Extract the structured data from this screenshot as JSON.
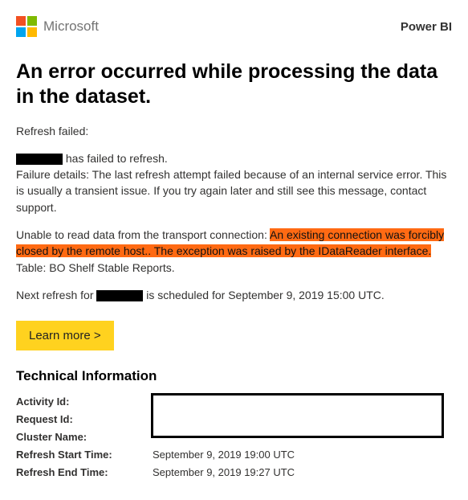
{
  "header": {
    "brand": "Microsoft",
    "product": "Power BI"
  },
  "title": "An error occurred while processing the data in the dataset.",
  "refresh_failed_label": "Refresh failed:",
  "body": {
    "failed_suffix": "has failed to refresh.",
    "failure_details": "Failure details: The last refresh attempt failed because of an internal service error. This is usually a transient issue. If you try again later and still see this message, contact support.",
    "unable_prefix": "Unable to read data from the transport connection: ",
    "highlighted": "An existing connection was forcibly closed by the remote host.. The exception was raised by the IDataReader interface.",
    "unable_suffix": " Table: BO Shelf Stable Reports.",
    "next_refresh_prefix": "Next refresh for ",
    "next_refresh_suffix": " is scheduled for September 9, 2019 15:00 UTC."
  },
  "learn_more": "Learn more >",
  "tech": {
    "heading": "Technical Information",
    "rows": {
      "activity_id": {
        "label": "Activity Id:"
      },
      "request_id": {
        "label": "Request Id:"
      },
      "cluster_name": {
        "label": "Cluster Name:"
      },
      "refresh_start": {
        "label": "Refresh Start Time:",
        "value": "September 9, 2019 19:00 UTC"
      },
      "refresh_end": {
        "label": "Refresh End Time:",
        "value": "September 9, 2019 19:27 UTC"
      }
    }
  }
}
